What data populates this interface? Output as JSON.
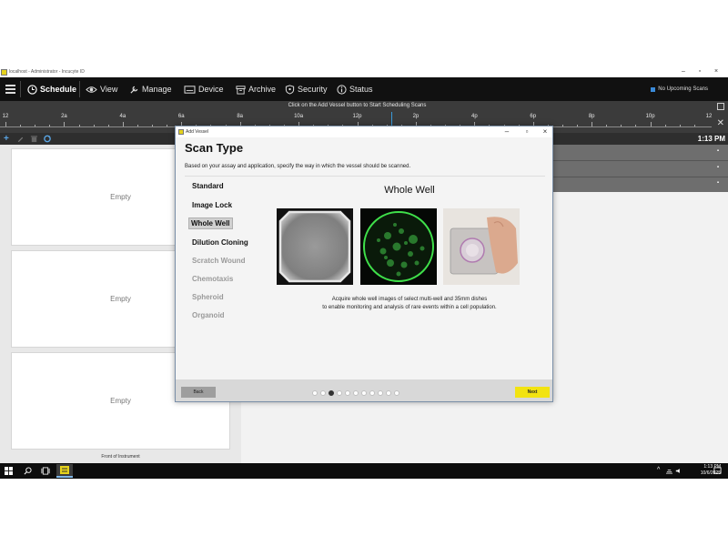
{
  "window": {
    "title": "localhost - Administrator - Incucyte ID",
    "minimize": "–",
    "maximize": "▫",
    "close": "×"
  },
  "nav": {
    "items": [
      {
        "label": "Schedule",
        "icon": "clock-icon",
        "active": true
      },
      {
        "label": "View",
        "icon": "eye-icon"
      },
      {
        "label": "Manage",
        "icon": "wrench-icon"
      },
      {
        "label": "Device",
        "icon": "device-icon"
      },
      {
        "label": "Archive",
        "icon": "archive-icon"
      },
      {
        "label": "Security",
        "icon": "shield-icon"
      },
      {
        "label": "Status",
        "icon": "info-icon"
      }
    ],
    "upcoming": "No Upcoming Scans",
    "upcoming_color": "#3a8ad8"
  },
  "timeline": {
    "message": "Click on the Add Vessel button to Start Scheduling Scans",
    "ticks": [
      "12",
      "2a",
      "4a",
      "6a",
      "8a",
      "10a",
      "12p",
      "2p",
      "4p",
      "6p",
      "8p",
      "10p",
      "12"
    ]
  },
  "toolbar": {
    "add": "+",
    "time": "1:13 PM"
  },
  "left_panel": {
    "slots": [
      "Empty",
      "Empty",
      "Empty"
    ],
    "footer": "Front of Instrument"
  },
  "dialog": {
    "title": "Add Vessel",
    "heading": "Scan Type",
    "description": "Based on your assay and application, specify the way in which the vessel should be scanned.",
    "options": [
      {
        "label": "Standard",
        "state": "enabled"
      },
      {
        "label": "Image Lock",
        "state": "enabled"
      },
      {
        "label": "Whole Well",
        "state": "selected"
      },
      {
        "label": "Dilution Cloning",
        "state": "enabled"
      },
      {
        "label": "Scratch Wound",
        "state": "disabled"
      },
      {
        "label": "Chemotaxis",
        "state": "disabled"
      },
      {
        "label": "Spheroid",
        "state": "disabled"
      },
      {
        "label": "Organoid",
        "state": "disabled"
      }
    ],
    "panel_title": "Whole Well",
    "panel_desc_line1": "Acquire whole well images of select multi-well and 35mm dishes",
    "panel_desc_line2": "to enable monitoring and analysis of rare events within a cell population.",
    "back": "Back",
    "next": "Next",
    "dots_total": 11,
    "dots_active": 3,
    "accent": "#f2e311"
  },
  "taskbar": {
    "time": "1:13 PM",
    "date": "10/6/2025"
  }
}
